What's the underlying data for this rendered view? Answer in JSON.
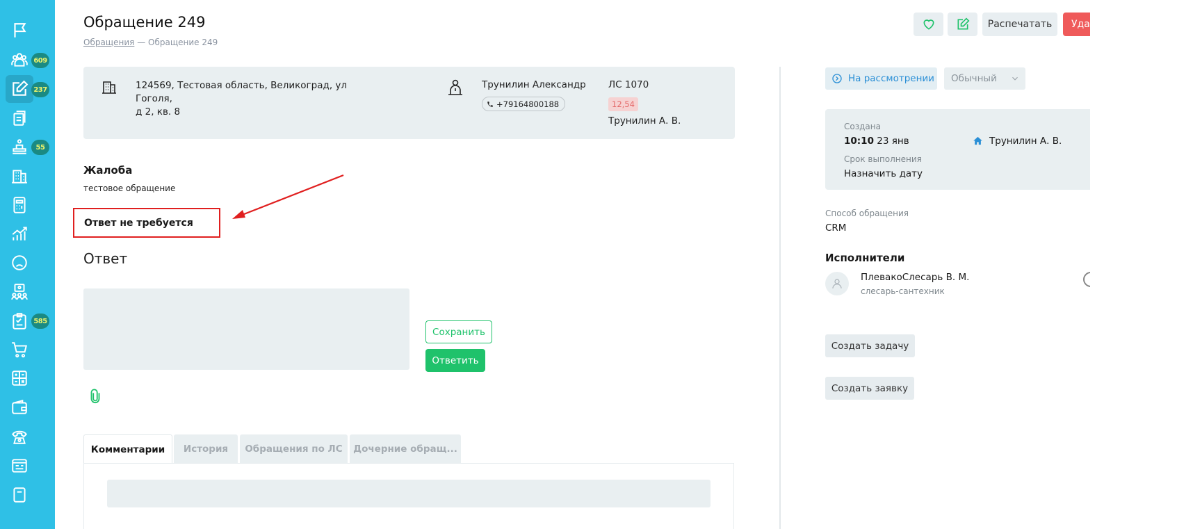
{
  "header": {
    "title": "Обращение 249",
    "breadcrumb_link": "Обращения",
    "breadcrumb_separator": "—",
    "breadcrumb_current": "Обращение 249",
    "print_label": "Распечатать",
    "delete_label": "Удал"
  },
  "sidebar": {
    "badges": {
      "residents": "609",
      "requests": "237",
      "meters": "55",
      "tasks": "585"
    }
  },
  "info": {
    "address_line1": "124569, Тестовая область, Великоград, ул Гоголя,",
    "address_line2": "д 2, кв. 8",
    "person_name": "Трунилин Александр",
    "phone": "+79164800188",
    "account": "ЛС 1070",
    "balance": "12,54",
    "owner": "Трунилин А. В."
  },
  "complaint": {
    "title": "Жалоба",
    "text": "тестовое обращение"
  },
  "no_answer_label": "Ответ не требуется",
  "answer": {
    "heading": "Ответ",
    "save_label": "Сохранить",
    "reply_label": "Ответить"
  },
  "tabs": [
    "Комментарии",
    "История",
    "Обращения по ЛС",
    "Дочерние обращ..."
  ],
  "side": {
    "status_label": "На рассмотрении",
    "priority_label": "Обычный",
    "created_label": "Создана",
    "created_time": "10:10",
    "created_date": "23 янв",
    "created_by": "Трунилин А. В.",
    "deadline_label": "Срок выполнения",
    "deadline_value": "Назначить дату",
    "method_label": "Способ обращения",
    "method_value": "CRM",
    "executors_title": "Исполнители",
    "executor_name": "ПлевакоСлесарь В. М.",
    "executor_role": "слесарь-сантехник",
    "create_task_label": "Создать задачу",
    "create_request_label": "Создать заявку"
  },
  "colors": {
    "sidebar": "#2fc0e6",
    "badge": "#1a8a83",
    "accent_green": "#1fc26b",
    "danger": "#ef5a5a",
    "annotation_red": "#e01f1f",
    "status_blue": "#2a8fd6"
  },
  "icons": [
    "flag-icon",
    "residents-icon",
    "edit-document-icon",
    "documents-icon",
    "meter-icon",
    "building-icon",
    "calculator-icon",
    "chart-icon",
    "sad-face-icon",
    "team-icon",
    "checklist-icon",
    "cart-icon",
    "calc-grid-icon",
    "wallet-icon",
    "phone-icon",
    "browser-icon",
    "heart-icon",
    "edit-icon",
    "building-icon",
    "person-icon",
    "phone-icon",
    "clock-icon",
    "chevron-down-icon",
    "home-icon",
    "avatar-icon",
    "paperclip-icon"
  ]
}
